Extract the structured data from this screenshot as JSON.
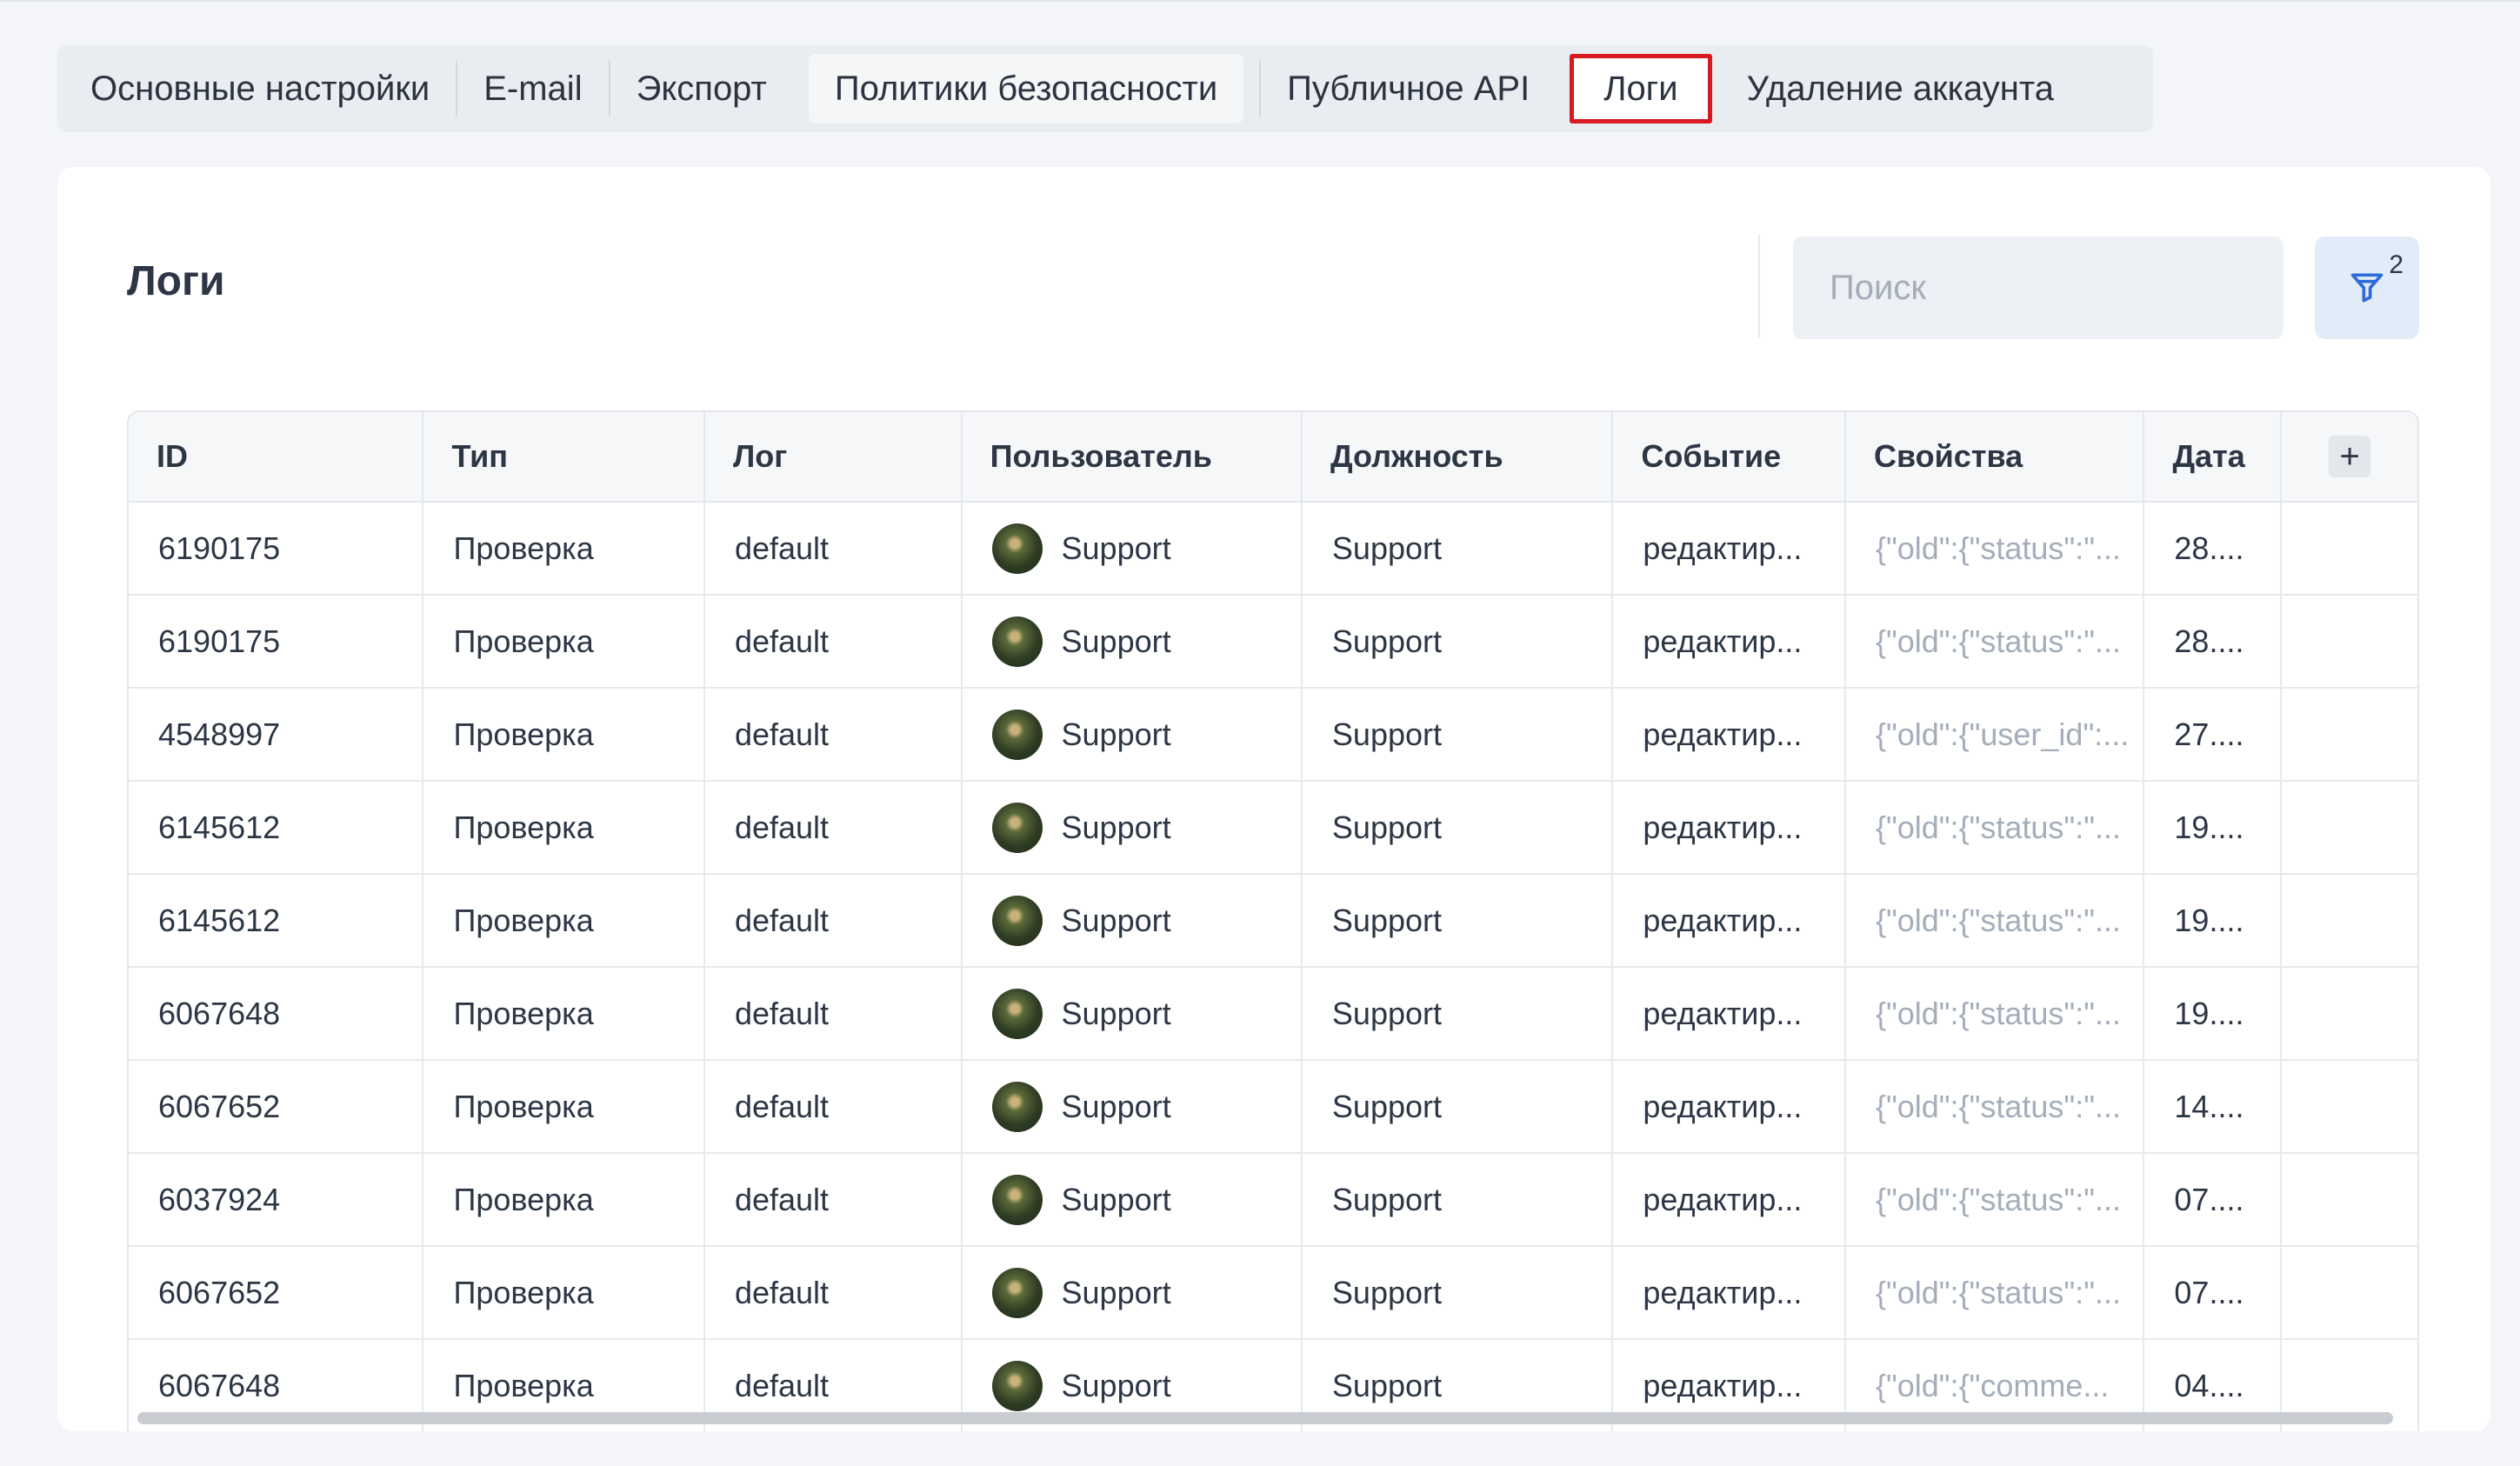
{
  "tabs": [
    {
      "label": "Основные настройки"
    },
    {
      "label": "E-mail"
    },
    {
      "label": "Экспорт"
    },
    {
      "label": "Политики безопасности"
    },
    {
      "label": "Публичное API"
    },
    {
      "label": "Логи"
    },
    {
      "label": "Удаление аккаунта"
    }
  ],
  "page": {
    "title": "Логи",
    "search_placeholder": "Поиск",
    "filter_count": "2",
    "filter_icon": "filter-icon"
  },
  "colors": {
    "selected_tab_border": "#d71920",
    "filter_button_bg": "#e2ecf9",
    "filter_icon": "#2f6bd8"
  },
  "table": {
    "columns": [
      "ID",
      "Тип",
      "Лог",
      "Пользователь",
      "Должность",
      "Событие",
      "Свойства",
      "Дата"
    ],
    "add_column_label": "+",
    "rows": [
      {
        "id": "6190175",
        "type": "Проверка",
        "log": "default",
        "user": "Support",
        "position": "Support",
        "event": "редактир...",
        "props": "{\"old\":{\"status\":\"...",
        "date": "28...."
      },
      {
        "id": "6190175",
        "type": "Проверка",
        "log": "default",
        "user": "Support",
        "position": "Support",
        "event": "редактир...",
        "props": "{\"old\":{\"status\":\"...",
        "date": "28...."
      },
      {
        "id": "4548997",
        "type": "Проверка",
        "log": "default",
        "user": "Support",
        "position": "Support",
        "event": "редактир...",
        "props": "{\"old\":{\"user_id\":...",
        "date": "27...."
      },
      {
        "id": "6145612",
        "type": "Проверка",
        "log": "default",
        "user": "Support",
        "position": "Support",
        "event": "редактир...",
        "props": "{\"old\":{\"status\":\"...",
        "date": "19...."
      },
      {
        "id": "6145612",
        "type": "Проверка",
        "log": "default",
        "user": "Support",
        "position": "Support",
        "event": "редактир...",
        "props": "{\"old\":{\"status\":\"...",
        "date": "19...."
      },
      {
        "id": "6067648",
        "type": "Проверка",
        "log": "default",
        "user": "Support",
        "position": "Support",
        "event": "редактир...",
        "props": "{\"old\":{\"status\":\"...",
        "date": "19...."
      },
      {
        "id": "6067652",
        "type": "Проверка",
        "log": "default",
        "user": "Support",
        "position": "Support",
        "event": "редактир...",
        "props": "{\"old\":{\"status\":\"...",
        "date": "14...."
      },
      {
        "id": "6037924",
        "type": "Проверка",
        "log": "default",
        "user": "Support",
        "position": "Support",
        "event": "редактир...",
        "props": "{\"old\":{\"status\":\"...",
        "date": "07...."
      },
      {
        "id": "6067652",
        "type": "Проверка",
        "log": "default",
        "user": "Support",
        "position": "Support",
        "event": "редактир...",
        "props": "{\"old\":{\"status\":\"...",
        "date": "07...."
      },
      {
        "id": "6067648",
        "type": "Проверка",
        "log": "default",
        "user": "Support",
        "position": "Support",
        "event": "редактир...",
        "props": "{\"old\":{\"comme...",
        "date": "04...."
      }
    ]
  }
}
